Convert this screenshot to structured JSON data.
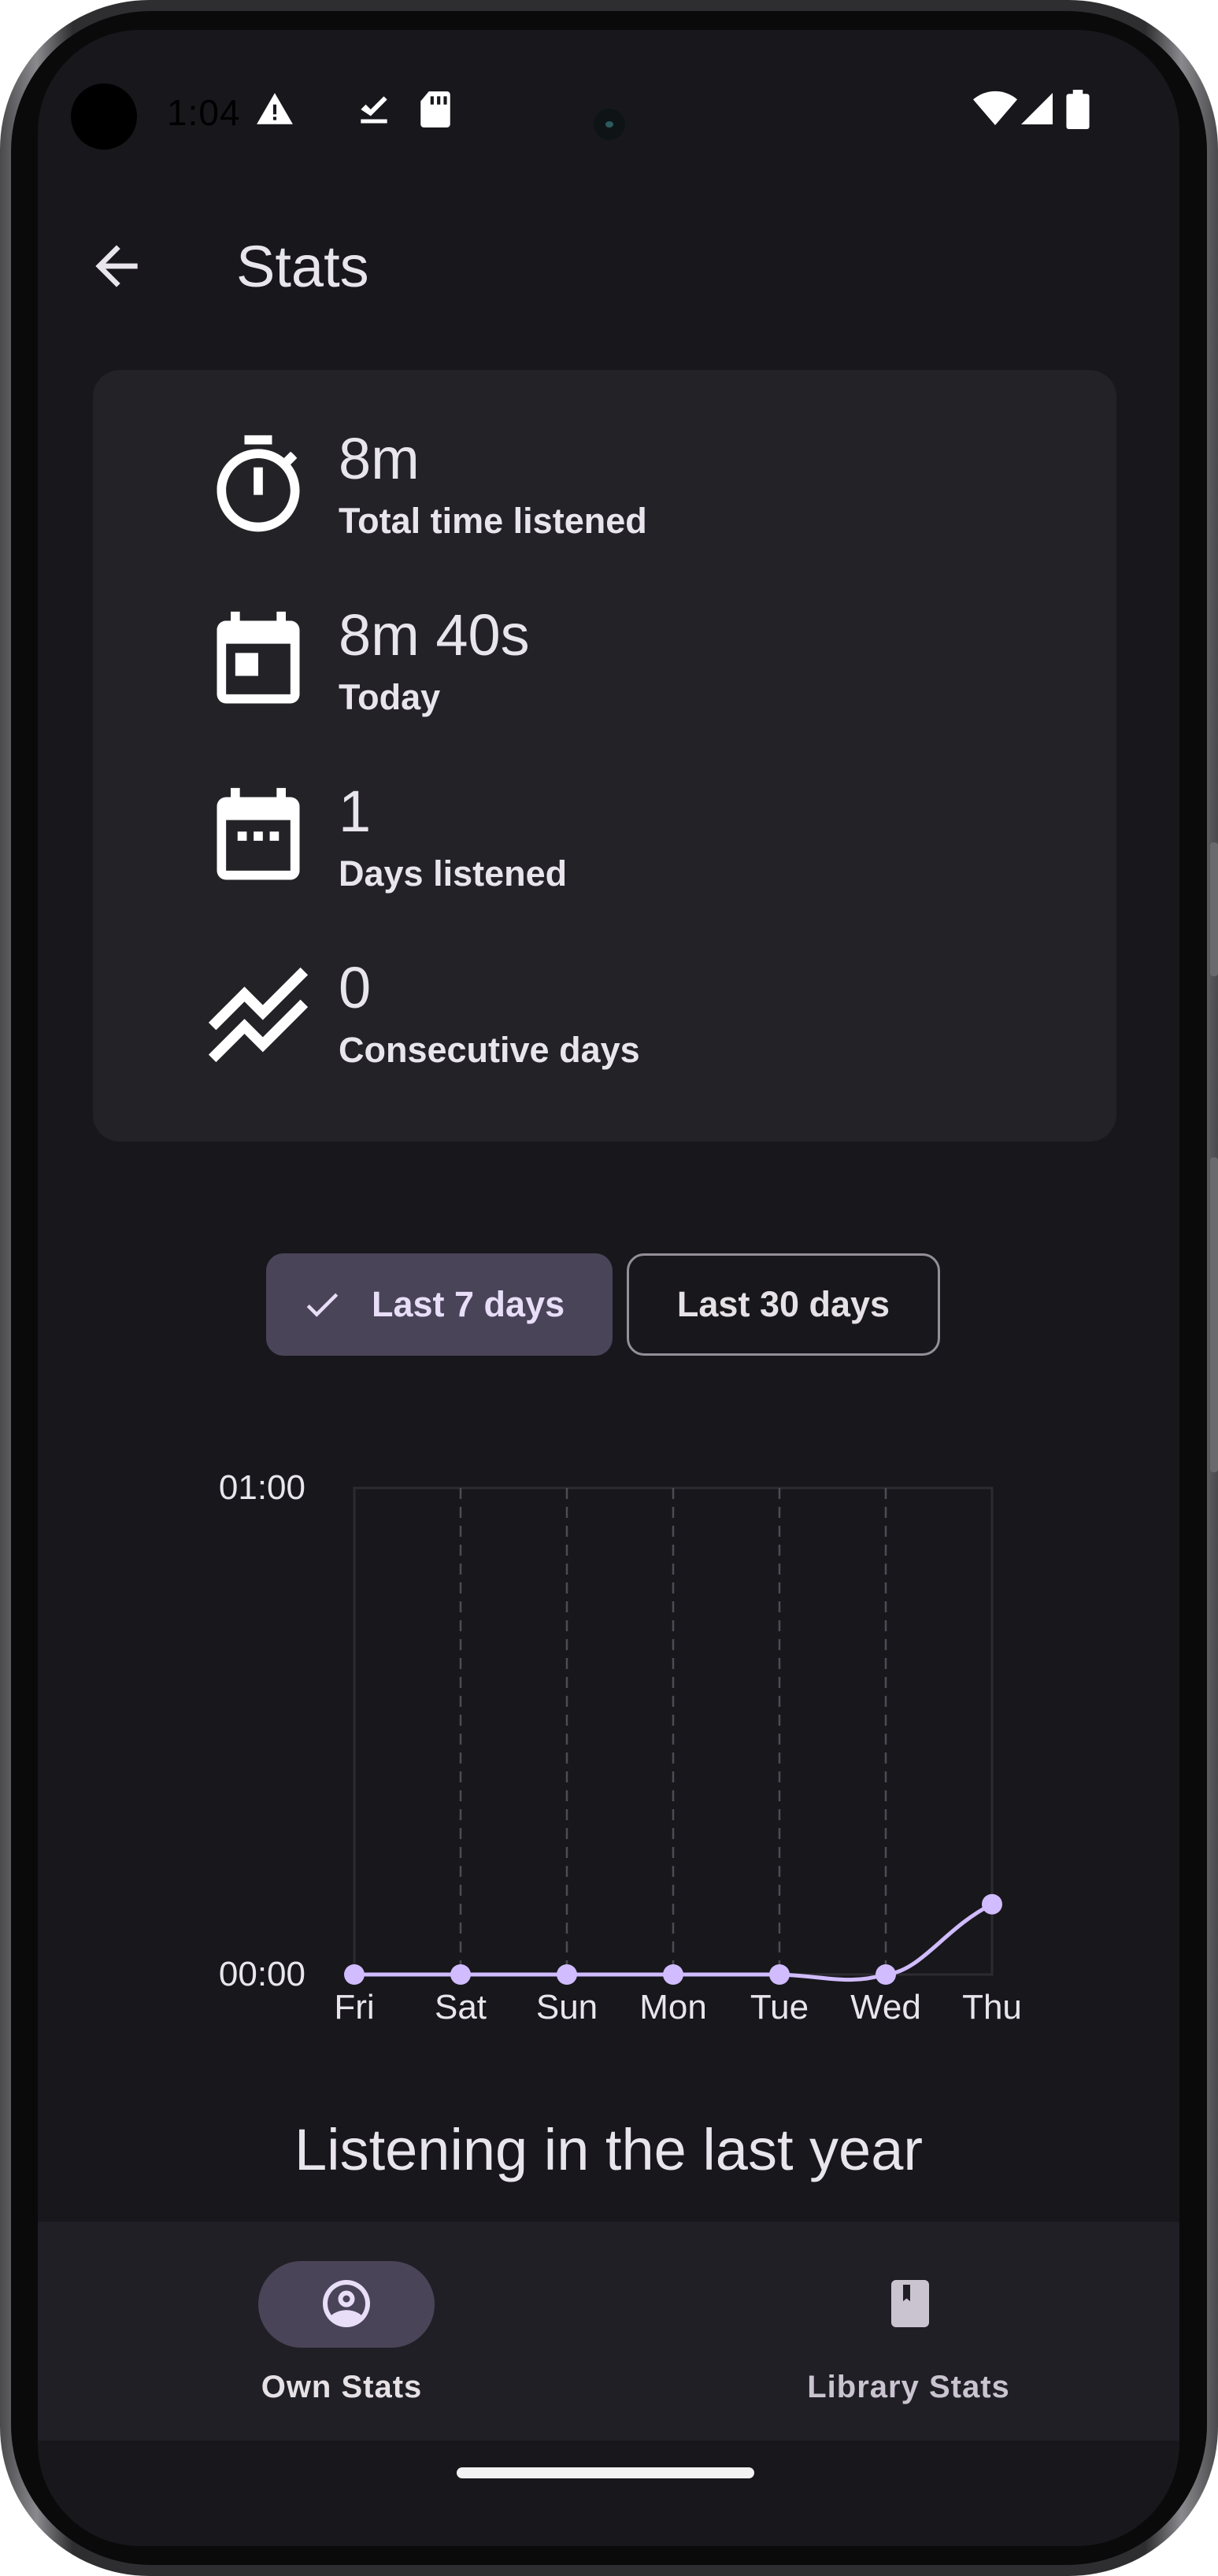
{
  "status_bar": {
    "time": "1:04",
    "icons_left": [
      "warning-icon",
      "task-done-icon",
      "sd-card-icon"
    ],
    "icons_right": [
      "wifi-icon",
      "cellular-signal-icon",
      "battery-icon"
    ]
  },
  "app_bar": {
    "back_icon": "arrow-back-icon",
    "title": "Stats"
  },
  "stats": [
    {
      "icon": "timer-icon",
      "value": "8m",
      "label": "Total time listened"
    },
    {
      "icon": "calendar-today-icon",
      "value": "8m 40s",
      "label": "Today"
    },
    {
      "icon": "calendar-days-icon",
      "value": "1",
      "label": "Days listened"
    },
    {
      "icon": "trending-icon",
      "value": "0",
      "label": "Consecutive days"
    }
  ],
  "filter_chips": {
    "selected": "Last 7 days",
    "other": "Last 30 days"
  },
  "chart_data": {
    "type": "line",
    "categories": [
      "Fri",
      "Sat",
      "Sun",
      "Mon",
      "Tue",
      "Wed",
      "Thu"
    ],
    "series": [
      {
        "values_minutes": [
          0,
          0,
          0,
          0,
          0,
          0,
          8.67
        ]
      }
    ],
    "y_tick_labels": [
      "01:00",
      "00:00"
    ],
    "ylim_minutes": [
      0,
      60
    ],
    "grid": "vertical dashed",
    "line_color": "#d0bcff"
  },
  "section_heading": "Listening in the last year",
  "bottom_nav": {
    "items": [
      {
        "icon": "account-circle-icon",
        "label": "Own Stats",
        "active": true
      },
      {
        "icon": "library-book-icon",
        "label": "Library Stats",
        "active": false
      }
    ]
  },
  "colors": {
    "background": "#18171c",
    "card": "#232227",
    "accent": "#d0bcff",
    "chip_selected": "#4a4458"
  }
}
